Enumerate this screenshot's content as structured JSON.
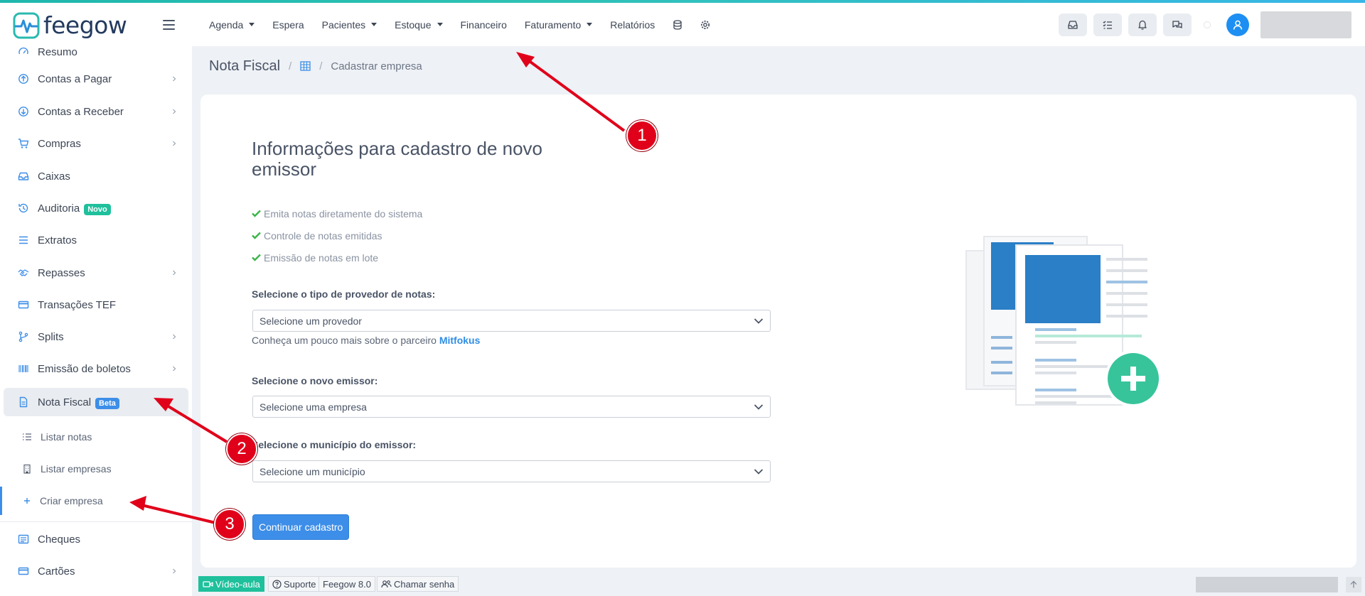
{
  "app": {
    "logo_text": "feegow"
  },
  "topnav": {
    "items": [
      {
        "label": "Agenda",
        "has_caret": true
      },
      {
        "label": "Espera",
        "has_caret": false
      },
      {
        "label": "Pacientes",
        "has_caret": true
      },
      {
        "label": "Estoque",
        "has_caret": true
      },
      {
        "label": "Financeiro",
        "has_caret": false
      },
      {
        "label": "Faturamento",
        "has_caret": true
      },
      {
        "label": "Relatórios",
        "has_caret": false
      }
    ],
    "icons": [
      "database-icon",
      "gear-icon"
    ]
  },
  "header_right": {
    "icons": [
      "inbox-icon",
      "checklist-icon",
      "bell-icon",
      "chat-icon",
      "status-dot-icon",
      "user-icon"
    ]
  },
  "sidebar": {
    "items": [
      {
        "label": "Resumo",
        "icon": "gauge-icon",
        "chevron": false
      },
      {
        "label": "Contas a Pagar",
        "icon": "arrow-up-circle-icon",
        "chevron": true
      },
      {
        "label": "Contas a Receber",
        "icon": "arrow-down-circle-icon",
        "chevron": true
      },
      {
        "label": "Compras",
        "icon": "cart-icon",
        "chevron": true
      },
      {
        "label": "Caixas",
        "icon": "tray-icon",
        "chevron": false
      },
      {
        "label": "Auditoria",
        "icon": "history-icon",
        "chevron": false,
        "badge": "Novo"
      },
      {
        "label": "Extratos",
        "icon": "list-icon",
        "chevron": false
      },
      {
        "label": "Repasses",
        "icon": "handshake-icon",
        "chevron": true
      },
      {
        "label": "Transações TEF",
        "icon": "card-icon",
        "chevron": false
      },
      {
        "label": "Splits",
        "icon": "branch-icon",
        "chevron": true
      },
      {
        "label": "Emissão de boletos",
        "icon": "barcode-icon",
        "chevron": true
      },
      {
        "label": "Nota Fiscal",
        "icon": "document-icon",
        "chevron": false,
        "badge": "Beta",
        "active": true
      }
    ],
    "subitems": [
      {
        "label": "Listar notas",
        "icon": "list-bullets-icon"
      },
      {
        "label": "Listar empresas",
        "icon": "building-icon"
      },
      {
        "label": "Criar empresa",
        "icon": "plus-icon",
        "current": true
      }
    ],
    "after_items": [
      {
        "label": "Cheques",
        "icon": "check-doc-icon",
        "chevron": false
      },
      {
        "label": "Cartões",
        "icon": "card-icon",
        "chevron": true
      }
    ]
  },
  "breadcrumb": {
    "title": "Nota Fiscal",
    "separator": "/",
    "current": "Cadastrar empresa"
  },
  "form": {
    "title": "Informações para cadastro de novo emissor",
    "features": [
      "Emita notas diretamente do sistema",
      "Controle de notas emitidas",
      "Emissão de notas em lote"
    ],
    "provider_label": "Selecione o tipo de provedor de notas:",
    "provider_value": "Selecione um provedor",
    "partner_text": "Conheça um pouco mais sobre o parceiro",
    "partner_link": "Mitfokus",
    "emitter_label": "Selecione o novo emissor:",
    "emitter_value": "Selecione uma empresa",
    "city_label": "Selecione o município do emissor:",
    "city_value": "Selecione um município",
    "submit_label": "Continuar cadastro"
  },
  "footer": {
    "video_label": "Vídeo-aula",
    "support_label": "Suporte",
    "version_label": "Feegow 8.0",
    "call_label": "Chamar senha"
  },
  "annotations": {
    "badges": [
      "1",
      "2",
      "3"
    ],
    "color": "#e0001a"
  },
  "colors": {
    "accent": "#3d8ee8",
    "brand": "#233a5e",
    "success": "#1fc09c"
  }
}
